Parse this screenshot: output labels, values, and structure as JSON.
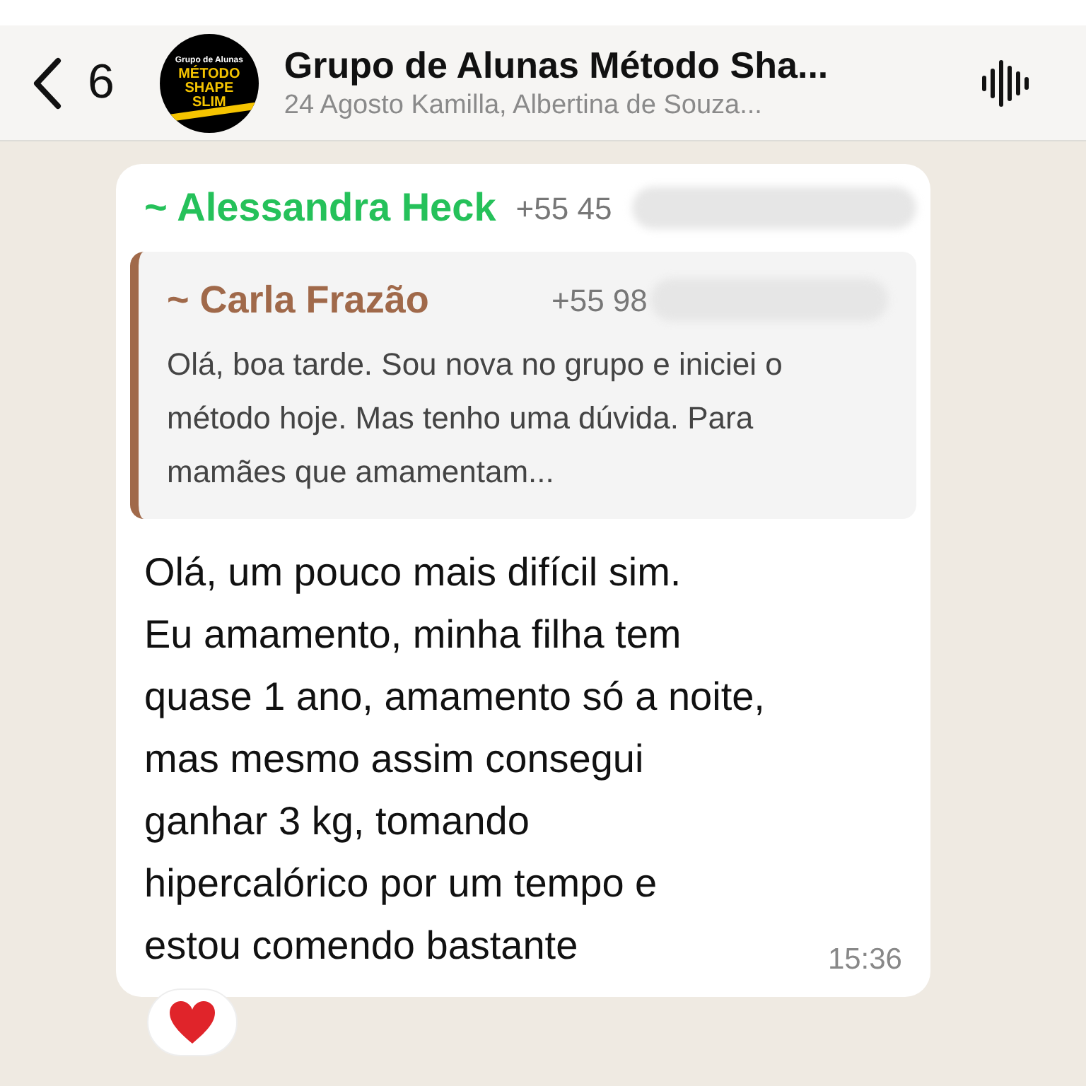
{
  "header": {
    "back_count": "6",
    "avatar": {
      "top_text": "Grupo de Alunas",
      "main_text": "MÉTODO SHAPE SLIM"
    },
    "title": "Grupo de Alunas Método Sha...",
    "subtitle": "24 Agosto Kamilla, Albertina de Souza..."
  },
  "message": {
    "sender": "~ Alessandra Heck",
    "sender_phone": "+55 45",
    "quote": {
      "sender": "~ Carla Frazão",
      "sender_phone": "+55 98",
      "text": "Olá, boa tarde. Sou nova no grupo e iniciei o método hoje. Mas tenho uma dúvida. Para mamães que amamentam..."
    },
    "lines": [
      "Olá, um pouco mais difícil sim.",
      "Eu amamento, minha filha tem",
      "quase 1 ano, amamento só a noite,",
      "mas mesmo assim consegui",
      "ganhar 3 kg, tomando",
      "hipercalórico por um tempo e",
      "estou comendo bastante"
    ],
    "time": "15:36",
    "reaction": {
      "kind": "heart"
    }
  }
}
